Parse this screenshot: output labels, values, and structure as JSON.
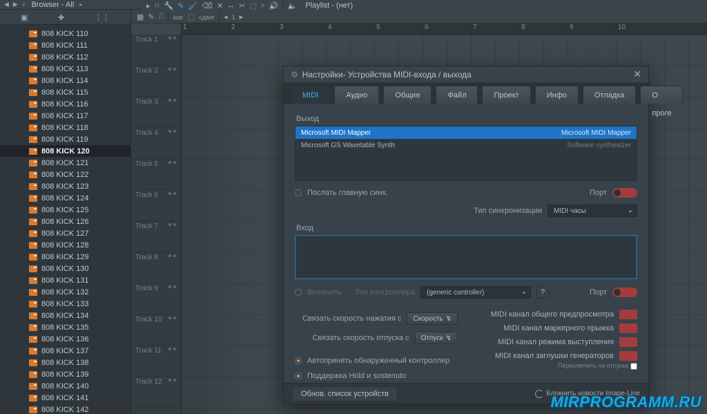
{
  "browser": {
    "title": "Browser - All",
    "items": [
      "808 KICK 110",
      "808 KICK 111",
      "808 KICK 112",
      "808 KICK 113",
      "808 KICK 114",
      "808 KICK 115",
      "808 KICK 116",
      "808 KICK 117",
      "808 KICK 118",
      "808 KICK 119",
      "808 KICK 120",
      "808 KICK 121",
      "808 KICK 122",
      "808 KICK 123",
      "808 KICK 124",
      "808 KICK 125",
      "808 KICK 126",
      "808 KICK 127",
      "808 KICK 128",
      "808 KICK 129",
      "808 KICK 130",
      "808 KICK 131",
      "808 KICK 132",
      "808 KICK 133",
      "808 KICK 134",
      "808 KICK 135",
      "808 KICK 136",
      "808 KICK 137",
      "808 KICK 138",
      "808 KICK 139",
      "808 KICK 140",
      "808 KICK 141",
      "808 KICK 142"
    ],
    "selected_index": 10
  },
  "playlist": {
    "title": "Playlist - (нет)",
    "subbar": {
      "step": "шаг",
      "shift": "сдвиг"
    },
    "ruler": [
      "1",
      "2",
      "3",
      "4",
      "5",
      "6",
      "7",
      "8",
      "9",
      "10"
    ],
    "tracks": [
      "Track 1",
      "Track 2",
      "Track 3",
      "Track 4",
      "Track 5",
      "Track 6",
      "Track 7",
      "Track 8",
      "Track 9",
      "Track 10",
      "Track 11",
      "Track 12"
    ]
  },
  "settings": {
    "title": "Настройки- Устройства MIDI-входа / выхода",
    "tabs": [
      "MIDI",
      "Аудио",
      "Общие",
      "Файл",
      "Проект",
      "Инфо",
      "Отладка",
      "О проге"
    ],
    "active_tab": 0,
    "out_label": "Выход",
    "out_list": [
      {
        "name": "Microsoft MIDI Mapper",
        "detail": "Microsoft MIDI Mapper"
      },
      {
        "name": "Microsoft GS Wavetable Synth",
        "detail": "Software synthesizer"
      }
    ],
    "send_master_sync": "Послать главную синх.",
    "port_label": "Порт",
    "sync_type_label": "Тип синхронизации",
    "sync_type_value": "MIDI часы",
    "in_label": "Вход",
    "enable_label": "Включить",
    "controller_type_label": "Тип контроллера",
    "controller_type_value": "(generic controller)",
    "link_velocity_press": "Связать скорость нажатия с",
    "link_velocity_press_val": "Скорость",
    "link_velocity_release": "Связать скорость отпуска с",
    "link_velocity_release_val": "Отпуск",
    "midi_ch_preview": "MIDI канал общего предпросмотра",
    "midi_ch_marker": "MIDI канал маркерного прыжка",
    "midi_ch_perform": "MIDI канал режима выступления",
    "midi_ch_gen": "MIDI канал заглушки генераторов",
    "switch_on_release": "Переключить на отпуске",
    "auto_accept": "Автопринять обнаруженный контроллер",
    "hold_sostenuto": "Поддержка Hold и sostenuto",
    "refresh_btn": "Обнов. список устройств",
    "news_link": "Блокнить новости Image-Line"
  },
  "watermark": "MIRPROGRAMM.RU"
}
